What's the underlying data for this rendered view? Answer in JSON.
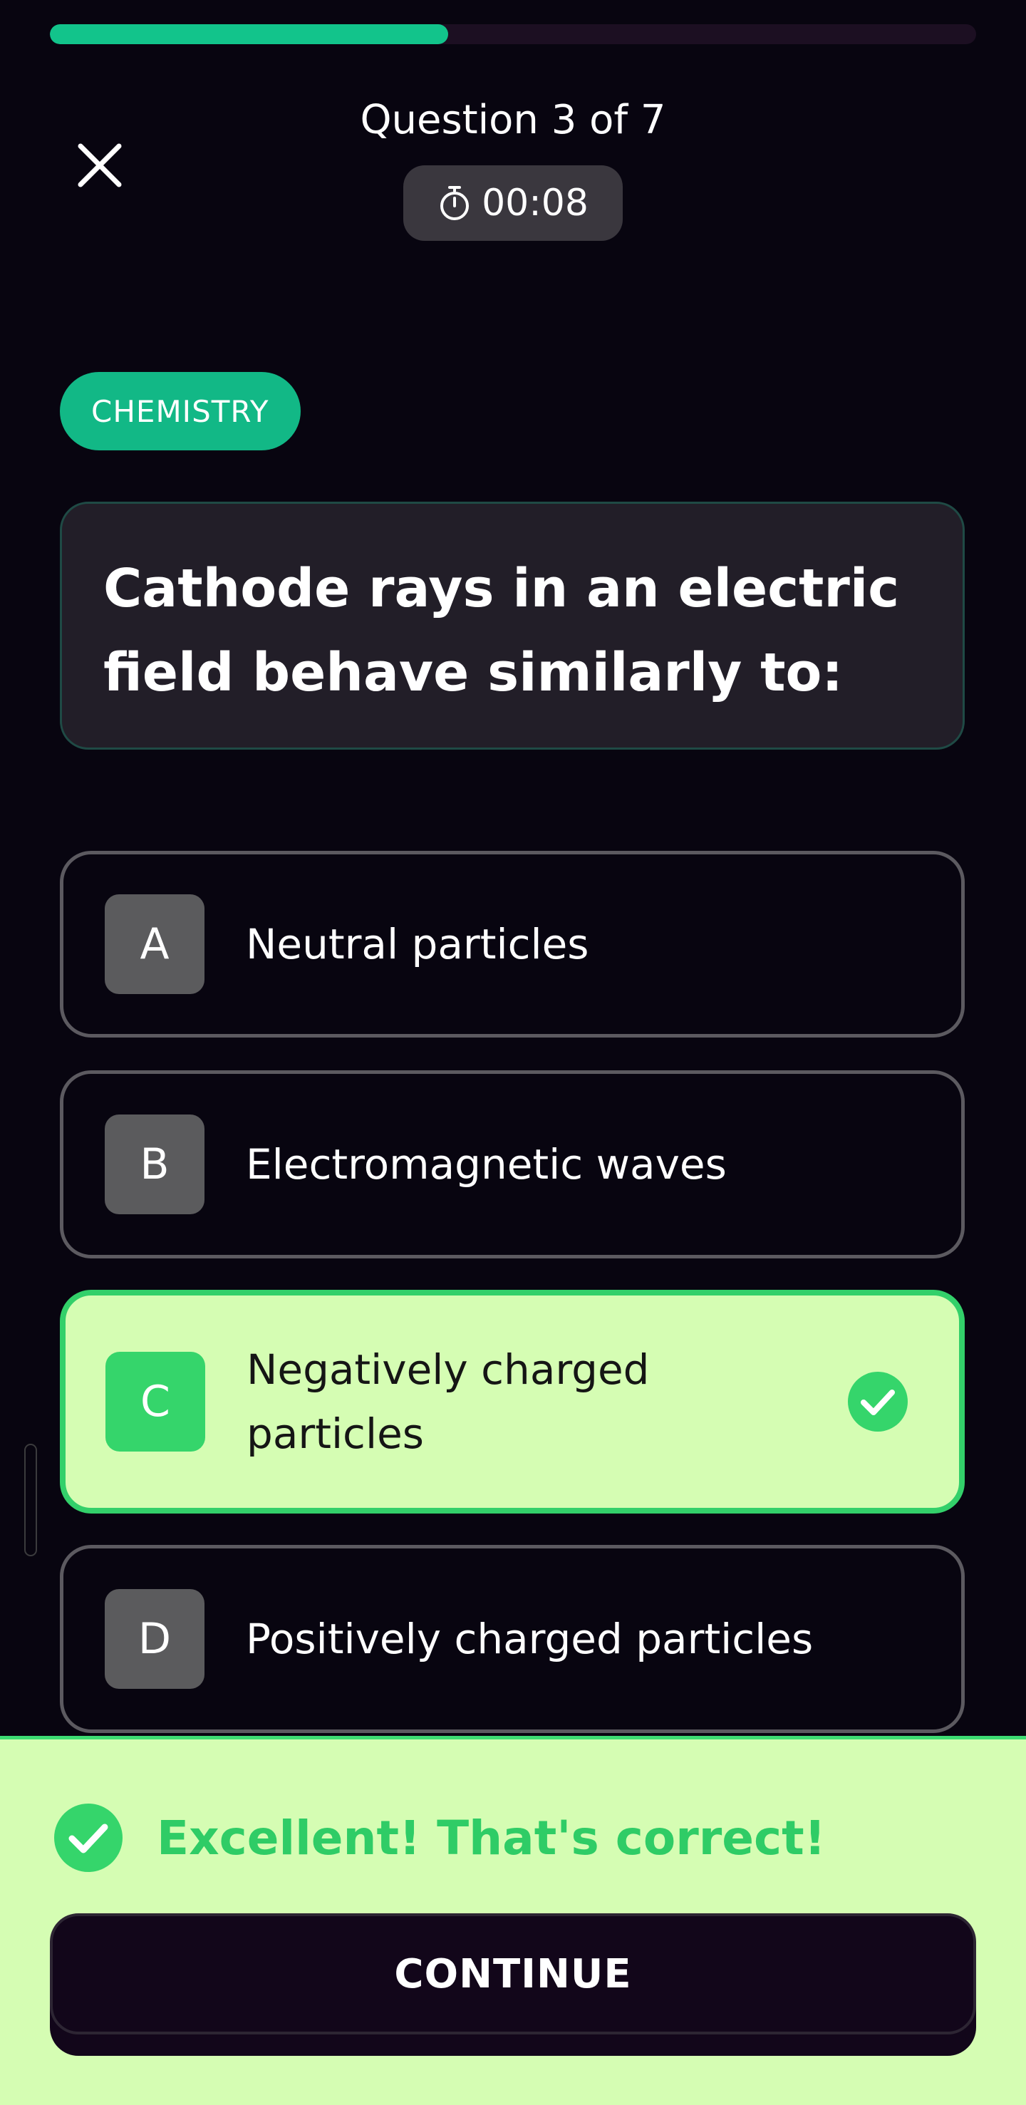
{
  "progress": {
    "fraction": 0.43,
    "fill_color": "#12c48b",
    "track_color": "#1c0f22"
  },
  "header": {
    "question_counter": "Question 3 of 7",
    "timer": "00:08",
    "close_icon": "close-icon",
    "timer_icon": "stopwatch-icon"
  },
  "category": {
    "label": "CHEMISTRY",
    "color": "#12b886"
  },
  "question": {
    "text": "Cathode rays in an electric field behave similarly to:"
  },
  "options": [
    {
      "letter": "A",
      "text": "Neutral particles",
      "state": "default"
    },
    {
      "letter": "B",
      "text": "Electromagnetic waves",
      "state": "default"
    },
    {
      "letter": "C",
      "text": "Negatively charged particles",
      "state": "correct"
    },
    {
      "letter": "D",
      "text": "Positively charged particles",
      "state": "default"
    }
  ],
  "feedback": {
    "message": "Excellent! That's correct!",
    "icon": "check-circle-icon",
    "color": "#2fcc66",
    "background": "#d5fdb3"
  },
  "continue_button": {
    "label": "CONTINUE"
  }
}
